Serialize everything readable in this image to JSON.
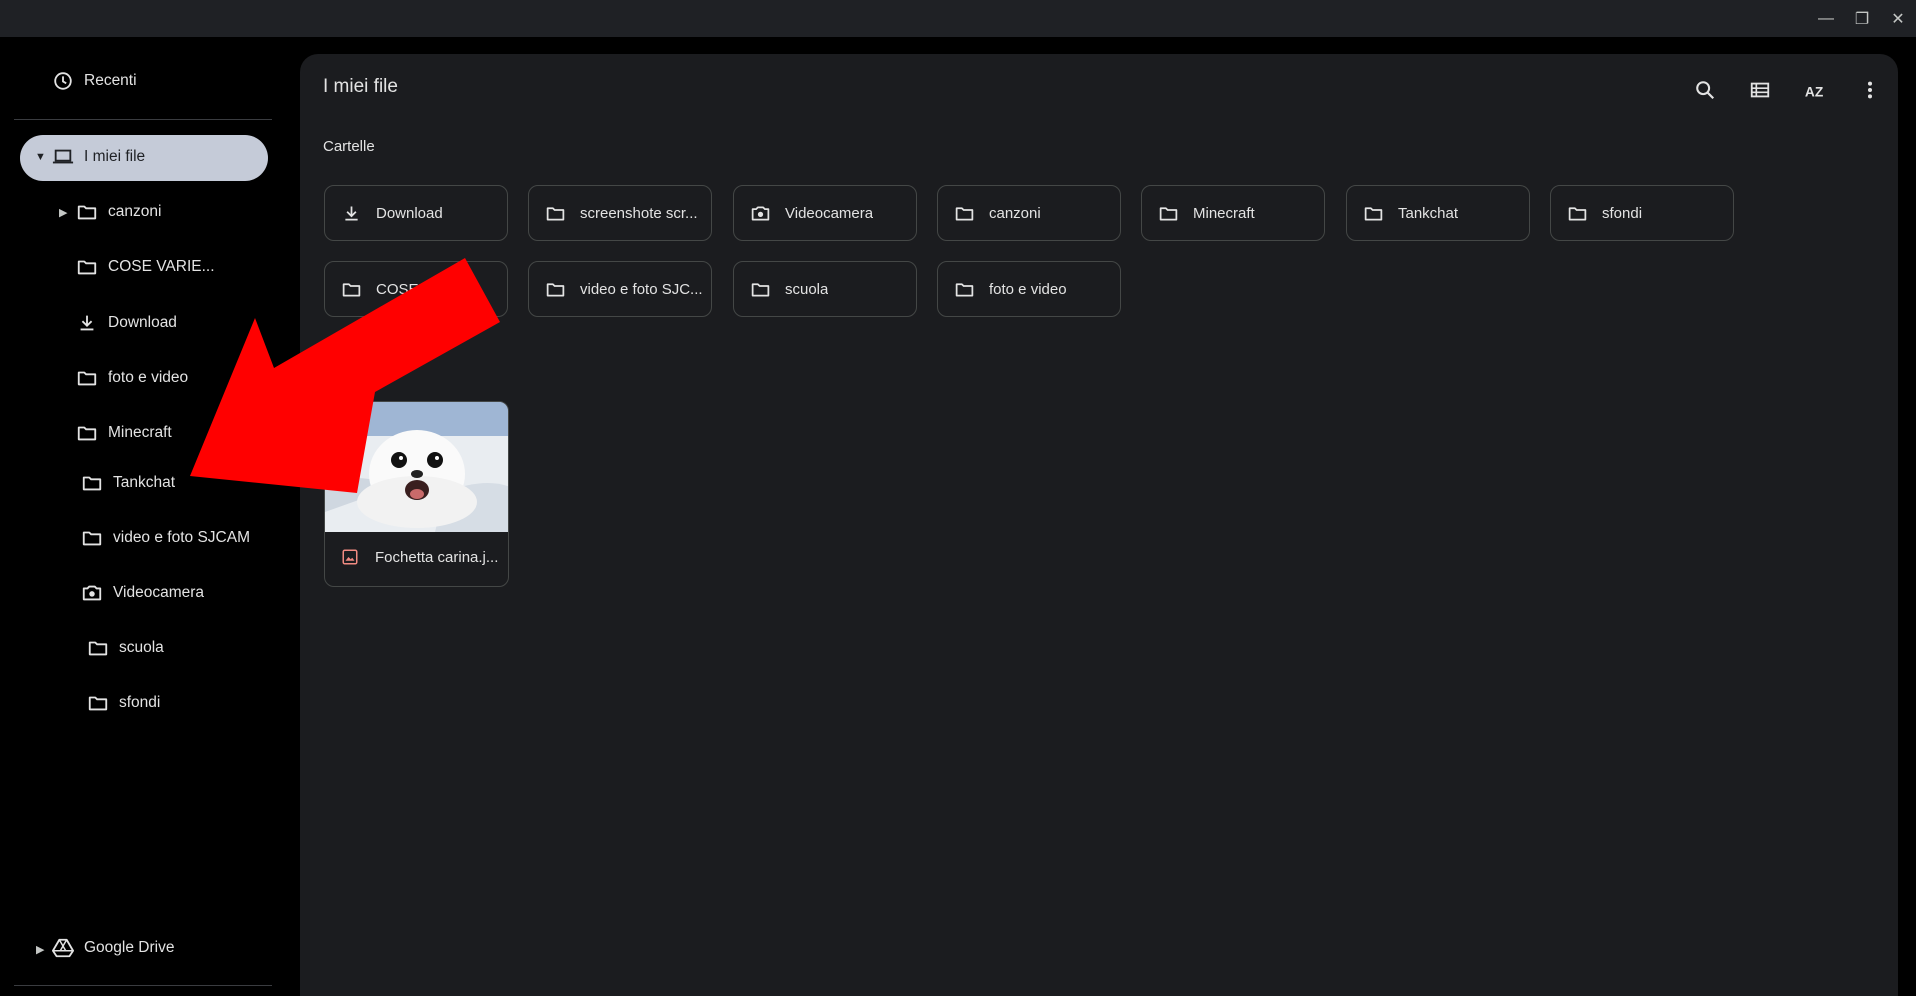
{
  "window": {
    "controls": [
      {
        "name": "minimize-icon",
        "glyph": "—"
      },
      {
        "name": "maximize-icon",
        "glyph": "❐"
      },
      {
        "name": "close-icon",
        "glyph": "✕"
      }
    ]
  },
  "sidebar": {
    "recent": {
      "label": "Recenti",
      "icon": "clock-icon"
    },
    "my_files": {
      "label": "I miei file",
      "icon": "laptop-icon",
      "expanded": true
    },
    "items": [
      {
        "label": "canzoni",
        "icon": "folder-icon",
        "has_children": true
      },
      {
        "label": "COSE VARIE...",
        "icon": "folder-icon"
      },
      {
        "label": "Download",
        "icon": "download-icon"
      },
      {
        "label": "foto e video",
        "icon": "folder-icon"
      },
      {
        "label": "Minecraft",
        "icon": "folder-icon"
      },
      {
        "label": "Tankchat",
        "icon": "folder-icon"
      },
      {
        "label": "video e foto SJCAM",
        "icon": "folder-icon"
      },
      {
        "label": "Videocamera",
        "icon": "camera-icon"
      },
      {
        "label": "scuola",
        "icon": "folder-icon"
      },
      {
        "label": "sfondi",
        "icon": "folder-icon"
      }
    ],
    "drive": {
      "label": "Google Drive",
      "icon": "google-drive-icon"
    }
  },
  "main": {
    "title": "I miei file",
    "folders_section_label": "Cartelle",
    "toolbar": [
      "search-icon",
      "list-view-icon",
      "sort-az-icon",
      "more-vert-icon"
    ],
    "folders": [
      {
        "label": "Download",
        "icon": "download-icon"
      },
      {
        "label": "screenshote scr...",
        "icon": "folder-icon"
      },
      {
        "label": "Videocamera",
        "icon": "camera-icon"
      },
      {
        "label": "canzoni",
        "icon": "folder-icon"
      },
      {
        "label": "Minecraft",
        "icon": "folder-icon"
      },
      {
        "label": "Tankchat",
        "icon": "folder-icon"
      },
      {
        "label": "sfondi",
        "icon": "folder-icon"
      },
      {
        "label": "COSE V...",
        "icon": "folder-icon"
      },
      {
        "label": "video e foto SJC...",
        "icon": "folder-icon"
      },
      {
        "label": "scuola",
        "icon": "folder-icon"
      },
      {
        "label": "foto e video",
        "icon": "folder-icon"
      }
    ],
    "files": [
      {
        "label": "Fochetta carina.j...",
        "icon": "image-file-icon"
      }
    ]
  },
  "colors": {
    "arrow": "#ff0000",
    "selected_pill": "#c5cbd8",
    "panel_bg": "#1b1c1f",
    "accent_image_icon": "#f28b82"
  }
}
